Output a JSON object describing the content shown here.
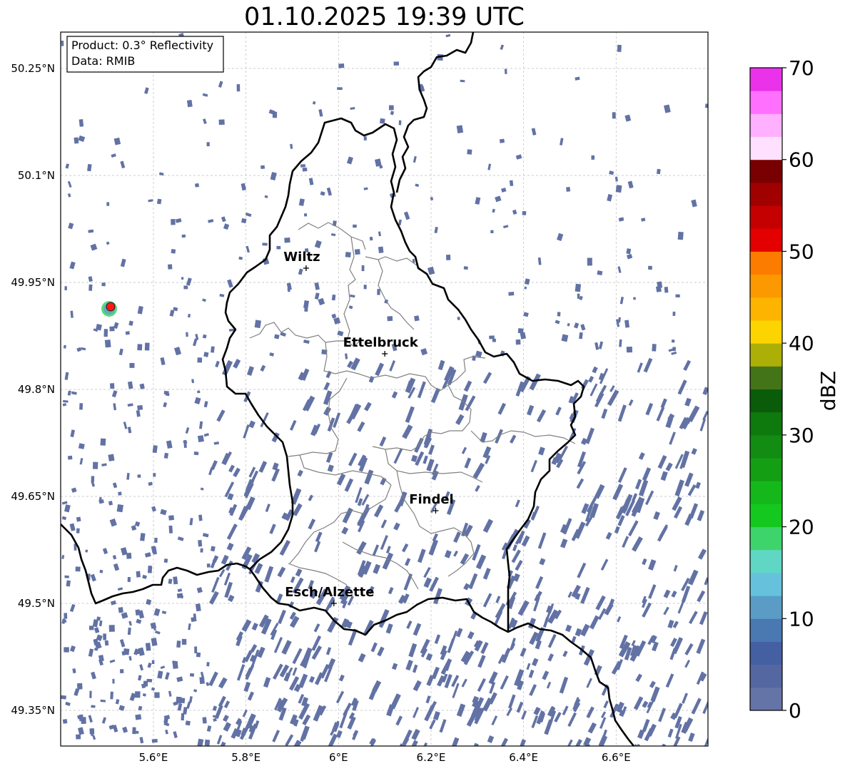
{
  "title": "01.10.2025 19:39 UTC",
  "info_box": {
    "product": "Product: 0.3° Reflectivity",
    "data": "Data: RMIB"
  },
  "map": {
    "lon_range": [
      5.4,
      6.8
    ],
    "lat_range": [
      49.3,
      50.3
    ],
    "lon_ticks": [
      {
        "value": 5.6,
        "label": "5.6°E"
      },
      {
        "value": 5.8,
        "label": "5.8°E"
      },
      {
        "value": 6.0,
        "label": "6°E"
      },
      {
        "value": 6.2,
        "label": "6.2°E"
      },
      {
        "value": 6.4,
        "label": "6.4°E"
      },
      {
        "value": 6.6,
        "label": "6.6°E"
      }
    ],
    "lat_ticks": [
      {
        "value": 50.25,
        "label": "50.25°N"
      },
      {
        "value": 50.1,
        "label": "50.1°N"
      },
      {
        "value": 49.95,
        "label": "49.95°N"
      },
      {
        "value": 49.8,
        "label": "49.8°N"
      },
      {
        "value": 49.65,
        "label": "49.65°N"
      },
      {
        "value": 49.5,
        "label": "49.5°N"
      },
      {
        "value": 49.35,
        "label": "49.35°N"
      }
    ],
    "gridlines": true,
    "cities": [
      {
        "name": "Wiltz",
        "lon": 5.93,
        "lat": 49.97
      },
      {
        "name": "Ettelbruck",
        "lon": 6.1,
        "lat": 49.85
      },
      {
        "name": "Findel",
        "lon": 6.21,
        "lat": 49.63
      },
      {
        "name": "Esch/Alzette",
        "lon": 5.99,
        "lat": 49.5
      }
    ],
    "radar_site": {
      "lon": 5.505,
      "lat": 49.914,
      "marker_color": "#ff1a1a"
    },
    "echo_color": "#6272a4",
    "border_color": "#000000",
    "canton_color": "#808080"
  },
  "colorbar": {
    "label": "dBZ",
    "ticks": [
      "0",
      "10",
      "20",
      "30",
      "40",
      "50",
      "60",
      "70"
    ],
    "colors": [
      "#6474a6",
      "#5567a0",
      "#4560a2",
      "#4a78b0",
      "#5a9cc6",
      "#66c2dc",
      "#60d6c4",
      "#3ed46c",
      "#14c820",
      "#14b81a",
      "#149e14",
      "#128c12",
      "#0e7a0e",
      "#0a5c0a",
      "#447418",
      "#acb006",
      "#fcd400",
      "#fcb400",
      "#fc9800",
      "#fc7c00",
      "#e40000",
      "#c40000",
      "#a00000",
      "#780000",
      "#ffe0ff",
      "#ffb0ff",
      "#ff70ff",
      "#ea32ea"
    ]
  }
}
